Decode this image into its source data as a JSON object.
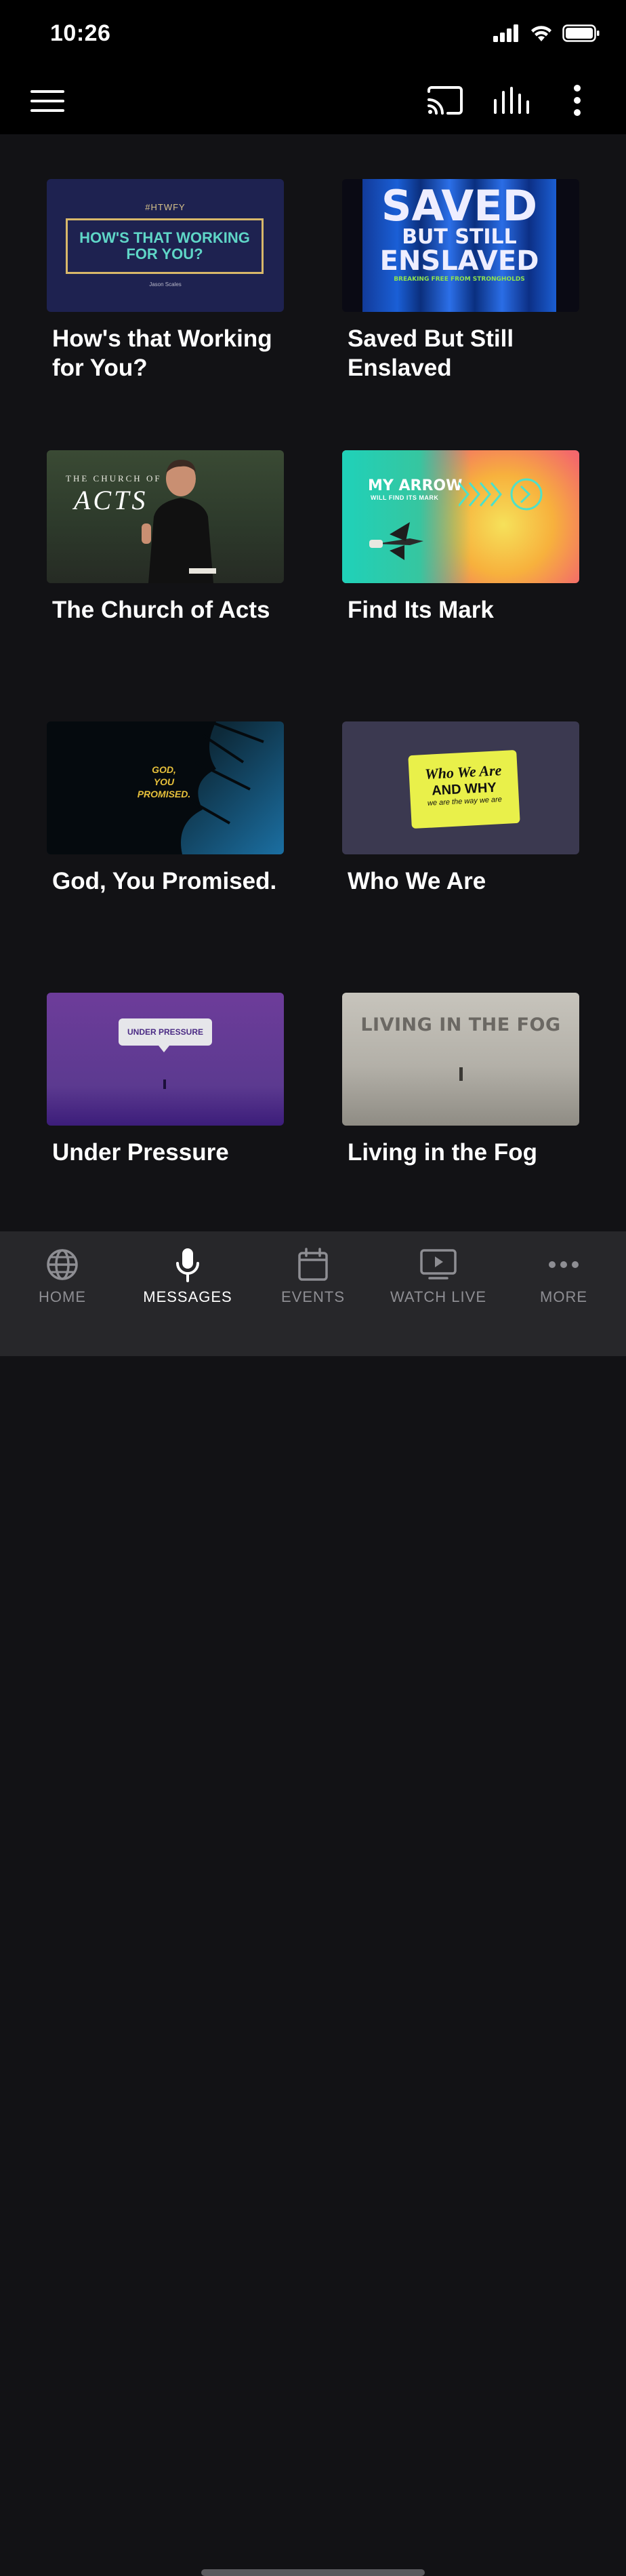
{
  "status_bar": {
    "time": "10:26"
  },
  "app_bar": {
    "menu_icon": "hamburger-menu-icon",
    "cast_icon": "cast-icon",
    "audio_icon": "audio-bars-icon",
    "more_icon": "vertical-ellipsis-icon"
  },
  "messages": [
    {
      "title": "How's that Working for You?",
      "art": {
        "tag": "#HTWFY",
        "text": "HOW'S THAT WORKING FOR YOU?",
        "author": "Jason Scales"
      }
    },
    {
      "title": "Saved But Still Enslaved",
      "art": {
        "line1": "SAVED",
        "line2": "BUT STILL",
        "line3": "ENSLAVED",
        "sub": "BREAKING FREE FROM STRONGHOLDS"
      }
    },
    {
      "title": "The Church of Acts",
      "art": {
        "line1": "THE CHURCH OF",
        "line2": "ACTS"
      }
    },
    {
      "title": "Find Its Mark",
      "art": {
        "line1": "MY ARROW",
        "line2": "WILL FIND ITS MARK"
      }
    },
    {
      "title": "God, You Promised.",
      "art": {
        "line1": "GOD,",
        "line2": "YOU",
        "line3": "PROMISED."
      }
    },
    {
      "title": "Who We Are",
      "art": {
        "line1": "Who We Are",
        "line2": "AND WHY",
        "line3": "we are the way we are"
      }
    },
    {
      "title": "Under Pressure",
      "art": {
        "bubble": "UNDER PRESSURE"
      }
    },
    {
      "title": "Living in the Fog",
      "art": {
        "text": "LIVING IN THE FOG"
      }
    }
  ],
  "tab_bar": {
    "tabs": [
      {
        "label": "HOME",
        "icon": "globe-icon"
      },
      {
        "label": "MESSAGES",
        "icon": "microphone-icon"
      },
      {
        "label": "EVENTS",
        "icon": "calendar-icon"
      },
      {
        "label": "WATCH LIVE",
        "icon": "tv-play-icon"
      },
      {
        "label": "MORE",
        "icon": "horizontal-ellipsis-icon"
      }
    ],
    "active": "MESSAGES"
  }
}
